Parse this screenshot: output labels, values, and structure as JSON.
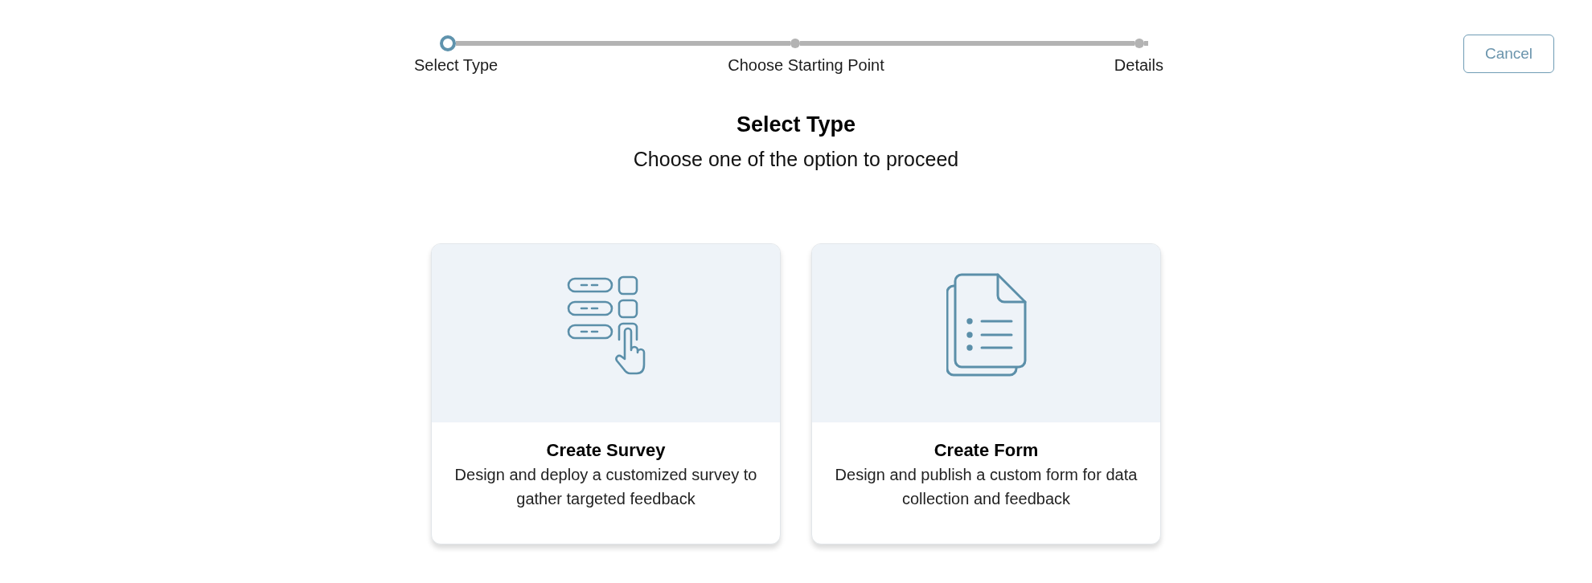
{
  "steps": [
    {
      "label": "Select Type",
      "current": true
    },
    {
      "label": "Choose Starting Point",
      "current": false
    },
    {
      "label": "Details",
      "current": false
    }
  ],
  "cancel_button": {
    "label": "Cancel"
  },
  "heading": {
    "title": "Select Type",
    "subtitle": "Choose one of the option to proceed"
  },
  "options": [
    {
      "kind": "survey",
      "title": "Create Survey",
      "description": "Design and deploy a customized survey to gather targeted feedback"
    },
    {
      "kind": "form",
      "title": "Create Form",
      "description": "Design and publish a custom form for data collection and feedback"
    }
  ]
}
